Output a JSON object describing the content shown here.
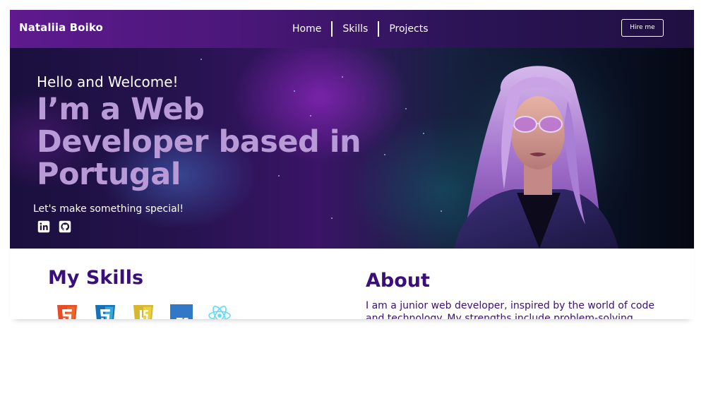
{
  "header": {
    "brand": "Nataliia Boiko",
    "nav": [
      "Home",
      "Skills",
      "Projects"
    ],
    "hire_label": "Hire me"
  },
  "hero": {
    "greeting": "Hello and Welcome!",
    "headline": "I’m a Web Developer based in Portugal",
    "tagline": "Let's make something special!",
    "social_icons": [
      "linkedin-icon",
      "github-icon"
    ]
  },
  "skills": {
    "title": "My Skills",
    "icons": [
      "html5-icon",
      "css3-icon",
      "javascript-icon",
      "typescript-icon",
      "react-icon"
    ],
    "ts_label": "TS"
  },
  "about": {
    "title": "About",
    "text": "I am a junior web developer, inspired by the world of code and technology. My strengths include problem-solving abilities"
  },
  "colors": {
    "header_gradient_start": "#5e1a8e",
    "header_gradient_end": "#1f1041",
    "headline": "#b89ad6",
    "section_title": "#3a0f7a",
    "html5": "#e44d26",
    "css3": "#1572b6",
    "javascript": "#d4b830",
    "typescript": "#3178c6",
    "react": "#61dafb"
  }
}
